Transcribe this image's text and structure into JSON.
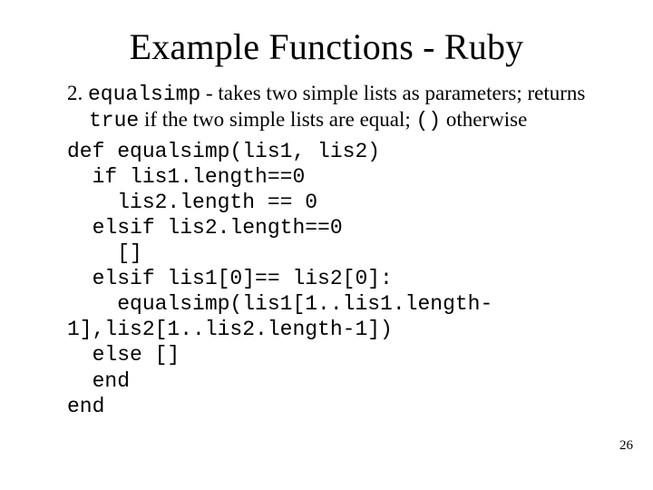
{
  "title": "Example Functions - Ruby",
  "desc": {
    "num": "2.",
    "fn": "equalsimp",
    "t1": " - takes two simple lists as parameters; returns ",
    "true": "true",
    "t2": " if the two simple lists are equal; ",
    "unit": "()",
    "t3": " otherwise"
  },
  "code": {
    "l1": "def equalsimp(lis1, lis2)",
    "l2": "  if lis1.length==0",
    "l3": "    lis2.length == 0",
    "l4": "  elsif lis2.length==0",
    "l5": "    []",
    "l6": "  elsif lis1[0]== lis2[0]:",
    "l7": "    equalsimp(lis1[1..lis1.length-",
    "l8": "1],lis2[1..lis2.length-1])",
    "l9": "  else []",
    "l10": "  end",
    "l11": "end"
  },
  "page": "26"
}
